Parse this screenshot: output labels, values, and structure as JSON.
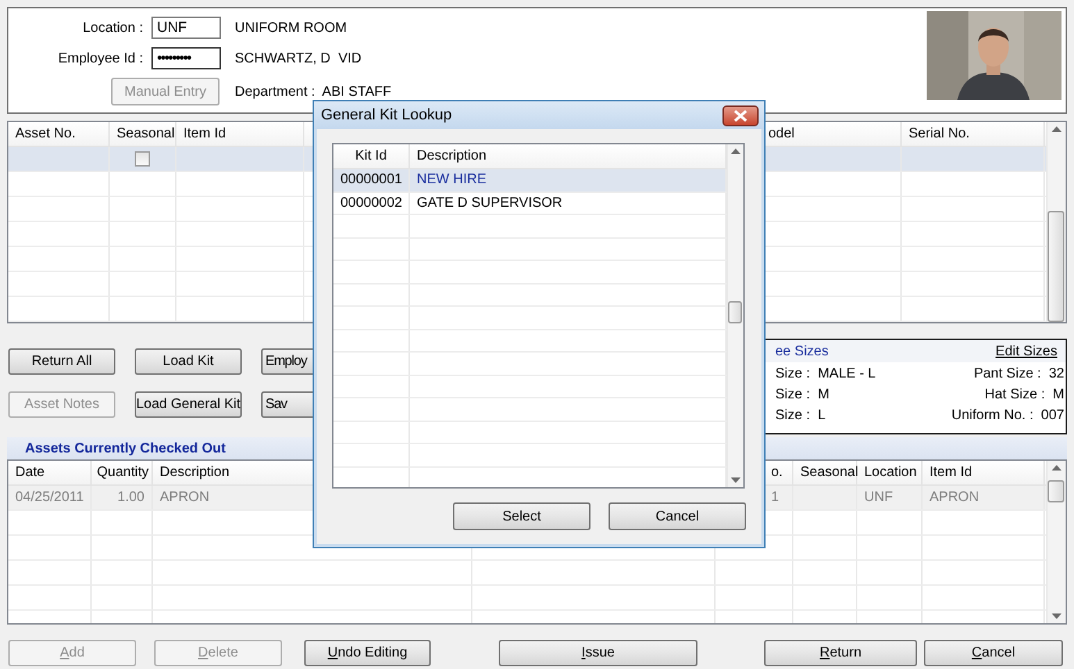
{
  "header": {
    "location": {
      "label": "Location :",
      "value": "UNF",
      "description": "UNIFORM ROOM"
    },
    "employee": {
      "label": "Employee Id :",
      "value": "•••••••••",
      "name": "SCHWARTZ, D  VID"
    },
    "manual_entry": {
      "label": "Manual Entry",
      "disabled": true
    },
    "department": {
      "label": "Department :",
      "value": "ABI STAFF"
    }
  },
  "assets_table": {
    "columns": [
      "Asset No.",
      "Seasonal",
      "Item Id",
      "",
      "odel",
      "Serial No."
    ],
    "rows": [
      {
        "selected": true,
        "seasonal_checked": false
      }
    ]
  },
  "action_buttons": [
    {
      "label": "Return All",
      "disabled": false
    },
    {
      "label": "Load Kit",
      "disabled": false
    },
    {
      "label": "Employ",
      "disabled": false
    },
    {
      "label": "Asset Notes",
      "disabled": true
    },
    {
      "label": "Load General Kit",
      "disabled": false
    },
    {
      "label": "Sav",
      "disabled": false
    }
  ],
  "sizes": {
    "title": "ee Sizes",
    "edit_link": "Edit Sizes",
    "items": [
      {
        "label": "Size :",
        "value": "MALE - L"
      },
      {
        "label": "Pant Size :",
        "value": "32"
      },
      {
        "label": "Size :",
        "value": "M"
      },
      {
        "label": "Hat Size :",
        "value": "M"
      },
      {
        "label": "Size :",
        "value": "L"
      },
      {
        "label": "Uniform No. :",
        "value": "007"
      }
    ]
  },
  "checked_out": {
    "title": "Assets Currently Checked Out",
    "columns": [
      "Date",
      "Quantity",
      "Description",
      "",
      "o.",
      "Seasonal",
      "Location",
      "Item Id"
    ],
    "rows": [
      {
        "selected": true,
        "cells": [
          "04/25/2011",
          "1.00",
          "APRON",
          "",
          "1",
          "",
          "UNF",
          "APRON"
        ]
      }
    ]
  },
  "bottom_buttons": [
    {
      "label": "Add",
      "disabled": true,
      "mnemonic": true
    },
    {
      "label": "Delete",
      "disabled": true,
      "mnemonic": true
    },
    {
      "label": "Undo Editing",
      "disabled": false,
      "mnemonic": true
    },
    {
      "label": "Issue",
      "disabled": false,
      "mnemonic": true
    },
    {
      "label": "Return",
      "disabled": false,
      "mnemonic": true
    },
    {
      "label": "Cancel",
      "disabled": false,
      "mnemonic": true
    }
  ],
  "dialog": {
    "title": "General Kit Lookup",
    "columns": [
      "Kit Id",
      "Description"
    ],
    "rows": [
      {
        "kit_id": "00000001",
        "description": "NEW HIRE",
        "selected": true
      },
      {
        "kit_id": "00000002",
        "description": "GATE D SUPERVISOR",
        "selected": false
      }
    ],
    "buttons": [
      {
        "label": "Select"
      },
      {
        "label": "Cancel"
      }
    ]
  }
}
